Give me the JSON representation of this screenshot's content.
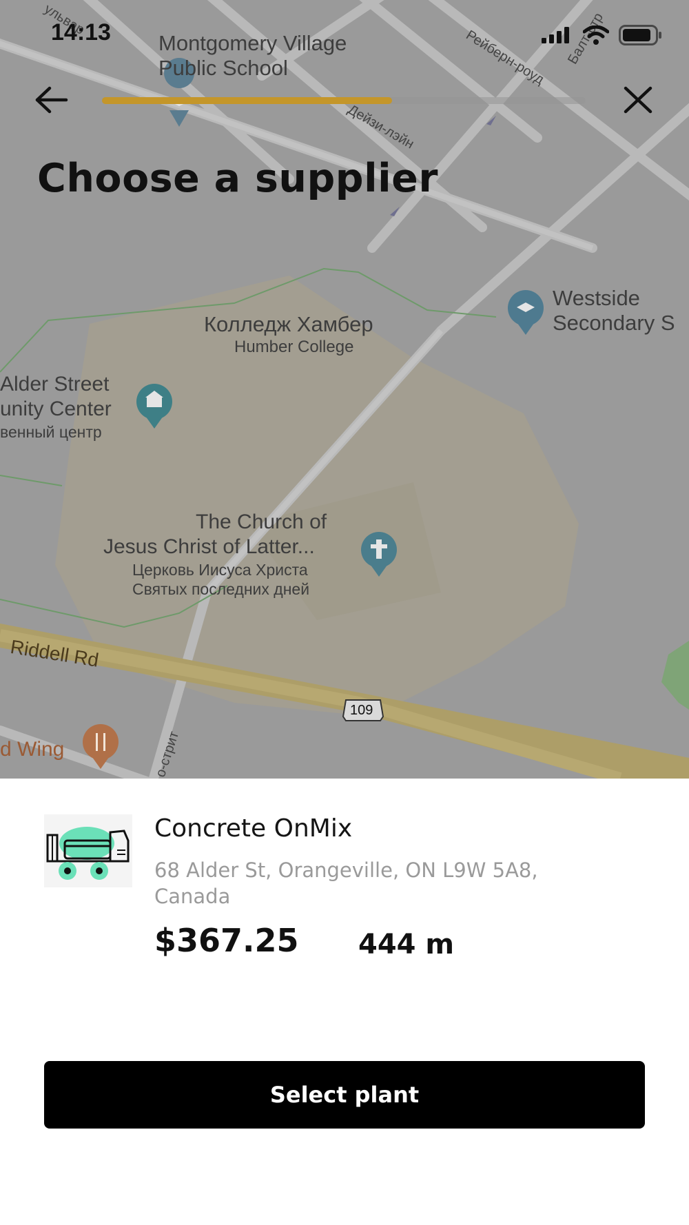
{
  "status_bar": {
    "time": "14:13",
    "icons": [
      "signal-icon",
      "wifi-icon",
      "battery-icon"
    ]
  },
  "nav": {
    "back_icon": "arrow-left-icon",
    "close_icon": "close-icon",
    "progress_fraction": 0.6,
    "progress_color": "#c4962a"
  },
  "page_title": "Choose a supplier",
  "map": {
    "labels": {
      "montgomery": "Montgomery Village",
      "montgomery2": "Public School",
      "westside": "Westside",
      "westside2": "Secondary S",
      "humber_ru": "Колледж Хамбер",
      "humber_en": "Humber College",
      "alder1": "Alder Street",
      "alder2": "unity Center",
      "alder3": "венный центр",
      "church1": "The Church of",
      "church2": "Jesus Christ of Latter...",
      "church3": "Церковь Иисуса Христа",
      "church4": "Святых последних дней",
      "riddell": "Riddell Rd",
      "route": "109",
      "wing": "d Wing",
      "rayburn": "Рейберн-роуд",
      "daisy": "Дейзи-лэйн",
      "street_bottom": "о-стрит",
      "street_top_left": "ульвар",
      "street_top_right": "Балт-стр"
    },
    "poi_icons": [
      "school-pin-icon",
      "school-pin-icon",
      "community-center-pin-icon",
      "church-pin-icon",
      "restaurant-pin-icon"
    ]
  },
  "supplier": {
    "name": "Concrete OnMix",
    "address": "68 Alder St, Orangeville, ON L9W 5A8, Canada",
    "price": "$367.25",
    "distance": "444 m",
    "thumbnail_icon": "concrete-mixer-truck-icon"
  },
  "cta": {
    "label": "Select plant"
  }
}
